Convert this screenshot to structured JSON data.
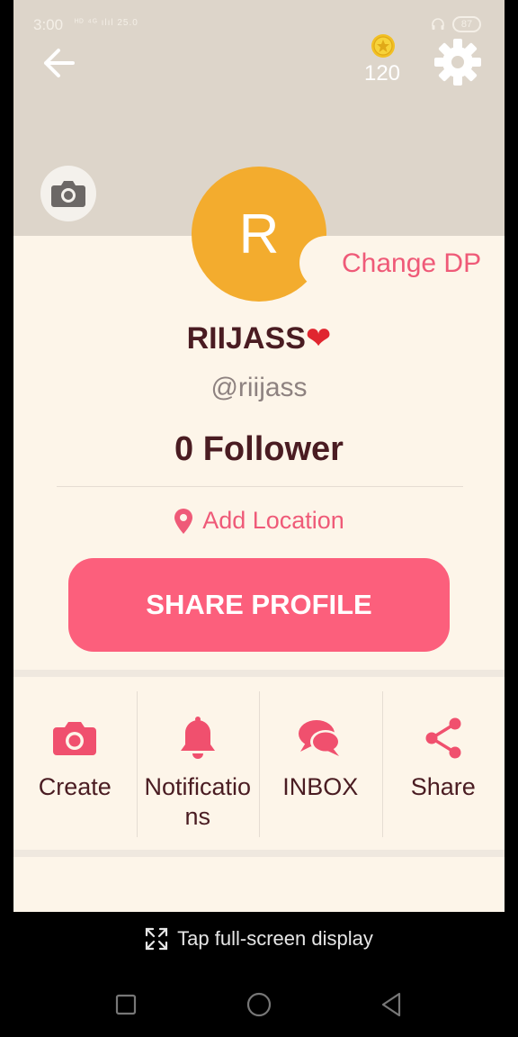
{
  "status_bar": {
    "time": "3:00",
    "network": "ᴴᴰ ⁴ᴳ ılıl 25.0",
    "battery": "87"
  },
  "header": {
    "coins": "120"
  },
  "profile": {
    "avatar_letter": "R",
    "change_dp_label": "Change DP",
    "name": "RIIJASS",
    "name_emoji": "❤",
    "handle": "@riijass",
    "followers": "0 Follower",
    "add_location_label": "Add Location",
    "share_button_label": "SHARE PROFILE"
  },
  "actions": [
    {
      "label": "Create",
      "icon": "camera-icon"
    },
    {
      "label": "Notifications",
      "icon": "bell-icon"
    },
    {
      "label": "INBOX",
      "icon": "chat-bubbles-icon"
    },
    {
      "label": "Share",
      "icon": "share-icon"
    }
  ],
  "system": {
    "fullscreen_tip": "Tap full-screen display"
  },
  "colors": {
    "accent": "#fc5f7c",
    "avatar": "#f3ac2e",
    "text_dark": "#4a1c22",
    "cover": "#ddd5ca",
    "background": "#fdf5e9"
  }
}
